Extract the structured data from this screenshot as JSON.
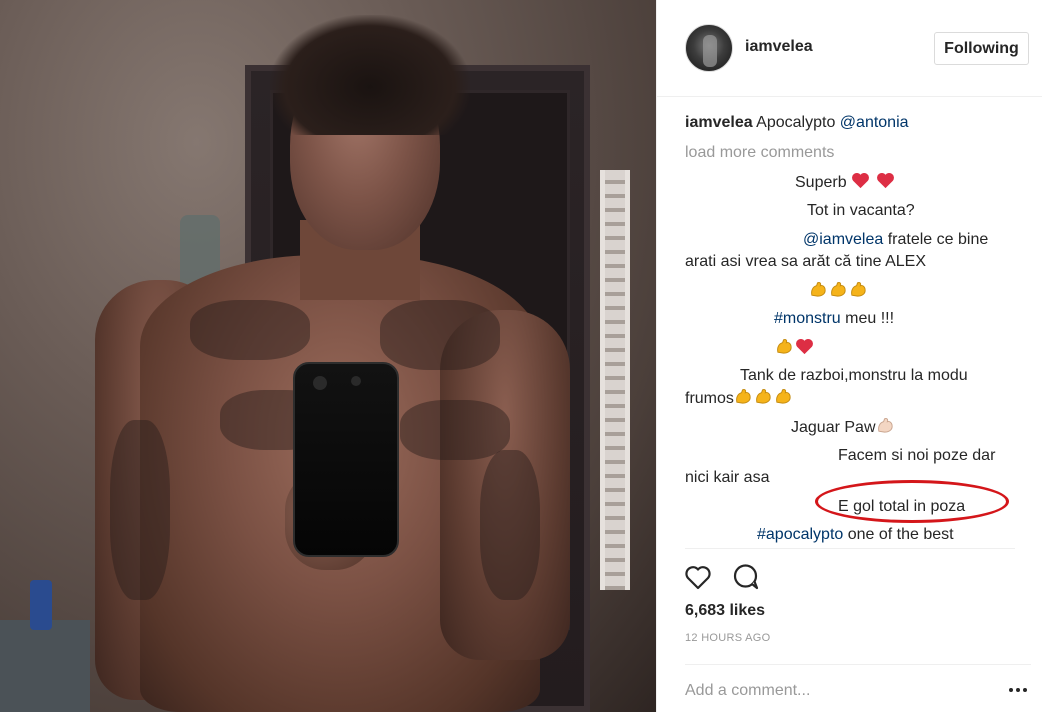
{
  "post": {
    "username": "iamvelea",
    "follow_button": "Following",
    "caption": {
      "user": "iamvelea",
      "text": "Apocalypto",
      "mention": "@antonia"
    },
    "load_more": "load more comments",
    "comments": [
      {
        "text": "Superb",
        "emoji": [
          "heart",
          "heart"
        ]
      },
      {
        "text": "Tot in vacanta?"
      },
      {
        "mention": "@iamvelea",
        "text": "fratele ce bine",
        "text2": "arati asi vrea sa arăt că tine ALEX"
      },
      {
        "emoji": [
          "flexed-biceps",
          "flexed-biceps",
          "flexed-biceps"
        ]
      },
      {
        "hashtag": "#monstru",
        "text": "meu !!!"
      },
      {
        "emoji": [
          "flexed-biceps",
          "heart"
        ]
      },
      {
        "text": "Tank de razboi,monstru la modu",
        "text2": "frumos",
        "emoji2": [
          "flexed-biceps",
          "flexed-biceps",
          "flexed-biceps"
        ]
      },
      {
        "text": "Jaguar Paw",
        "emoji": [
          "flexed-biceps-light"
        ]
      },
      {
        "text": "Facem si noi poze dar",
        "text2": "nici kair asa"
      },
      {
        "text": "E gol total in poza",
        "highlight_color": "#d4161a"
      },
      {
        "hashtag": "#apocalypto",
        "text": "one of the best"
      }
    ],
    "likes": "6,683 likes",
    "timestamp": "12 HOURS AGO",
    "add_comment_placeholder": "Add a comment..."
  },
  "colors": {
    "link": "#003569",
    "muted": "#999999",
    "text": "#262626",
    "highlight": "#d4161a"
  }
}
